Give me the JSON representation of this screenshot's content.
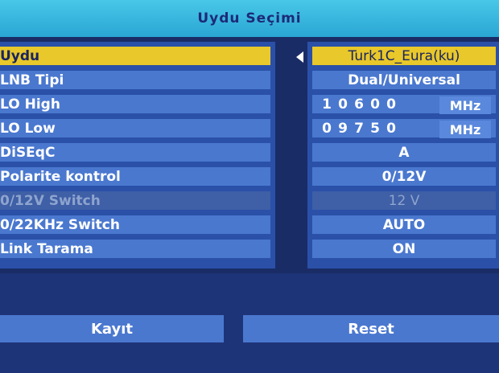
{
  "title": "Uydu Seçimi",
  "rows": [
    {
      "label": "Uydu",
      "value": "Turk1C_Eura(ku)",
      "state": "selected"
    },
    {
      "label": "LNB Tipi",
      "value": "Dual/Universal",
      "state": "normal"
    },
    {
      "label": "LO High",
      "digits": [
        "1",
        "0",
        "6",
        "0",
        "0"
      ],
      "unit": "MHz",
      "state": "normal"
    },
    {
      "label": "LO Low",
      "digits": [
        "0",
        "9",
        "7",
        "5",
        "0"
      ],
      "unit": "MHz",
      "state": "normal"
    },
    {
      "label": "DiSEqC",
      "value": "A",
      "state": "normal"
    },
    {
      "label": "Polarite kontrol",
      "value": "0/12V",
      "state": "normal"
    },
    {
      "label": "0/12V Switch",
      "value": "12 V",
      "state": "disabled"
    },
    {
      "label": "0/22KHz Switch",
      "value": "AUTO",
      "state": "normal"
    },
    {
      "label": "Link Tarama",
      "value": "ON",
      "state": "normal"
    }
  ],
  "buttons": {
    "save": "Kayıt",
    "reset": "Reset"
  },
  "colors": {
    "selected": "#e8c82a",
    "row": "#4a78cf",
    "title": "#2aa6d4"
  }
}
